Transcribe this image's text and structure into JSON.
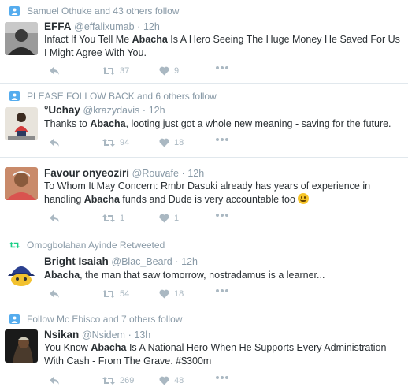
{
  "tweets": [
    {
      "context": "Samuel Othuke and 43 others follow",
      "context_type": "follow",
      "name": "EFFA",
      "handle": "@effalixumab",
      "sep": "·",
      "time": "12h",
      "text_parts": [
        "Infact If You Tell Me ",
        "Abacha",
        " Is A Hero Seeing The Huge Money He Saved For Us I Might Agree With You."
      ],
      "retweets": "37",
      "likes": "9"
    },
    {
      "context": "PLEASE FOLLOW BACK and 6 others follow",
      "context_type": "follow",
      "name": "°Uchay",
      "handle": "@krazydavis",
      "sep": "·",
      "time": "12h",
      "text_parts": [
        "Thanks to ",
        "Abacha",
        ", looting just got a whole new meaning - saving for the future."
      ],
      "retweets": "94",
      "likes": "18"
    },
    {
      "context": "",
      "name": "Favour onyeoziri",
      "handle": "@Rouvafe",
      "sep": "·",
      "time": "12h",
      "text_parts": [
        "To Whom It May Concern: Rmbr Dasuki already has years of experience in handling ",
        "Abacha",
        " funds and Dude is very accountable too "
      ],
      "retweets": "1",
      "likes": "1"
    },
    {
      "context": "Omogbolahan Ayinde Retweeted",
      "context_type": "retweet",
      "name": "Bright Isaiah",
      "handle": "@Blac_Beard",
      "sep": "·",
      "time": "12h",
      "text_parts": [
        "",
        "Abacha",
        ", the man that saw tomorrow, nostradamus is a learner..."
      ],
      "retweets": "54",
      "likes": "18"
    },
    {
      "context": "Follow Mc Ebisco and 7 others follow",
      "context_type": "follow",
      "name": "Nsikan",
      "handle": "@Nsidem",
      "sep": "·",
      "time": "13h",
      "text_parts": [
        "You Know ",
        "Abacha",
        " Is A National Hero When He Supports Every Administration With Cash - From The Grave. #$300m"
      ],
      "retweets": "269",
      "likes": "48"
    }
  ],
  "colors": {
    "accent": "#55acee",
    "retweet_green": "#19cf86",
    "muted": "#8899a6",
    "icon": "#aab8c2"
  },
  "icons": {
    "reply": "reply-icon",
    "retweet": "retweet-icon",
    "like": "heart-icon",
    "more": "more-icon"
  }
}
